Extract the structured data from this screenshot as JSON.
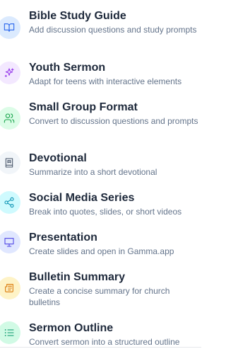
{
  "items": [
    {
      "title": "Bible Study Guide",
      "description": "Add discussion questions and study prompts",
      "icon": "book-open-icon",
      "color": "#2563eb",
      "bg": "#dbeafe"
    },
    {
      "title": "Youth Sermon",
      "description": "Adapt for teens with interactive elements",
      "icon": "sparkles-icon",
      "color": "#9333ea",
      "bg": "#f3e8ff"
    },
    {
      "title": "Small Group Format",
      "description": "Convert to discussion questions and prompts",
      "icon": "users-icon",
      "color": "#16a34a",
      "bg": "#dcfce7"
    },
    {
      "title": "Devotional",
      "description": "Summarize into a short devotional",
      "icon": "bookmark-book-icon",
      "color": "#475569",
      "bg": "#f1f5f9"
    },
    {
      "title": "Social Media Series",
      "description": "Break into quotes, slides, or short videos",
      "icon": "share-icon",
      "color": "#0891b2",
      "bg": "#cffafe"
    },
    {
      "title": "Presentation",
      "description": "Create slides and open in Gamma.app",
      "icon": "presentation-icon",
      "color": "#4f46e5",
      "bg": "#e0e7ff"
    },
    {
      "title": "Bulletin Summary",
      "description": "Create a concise summary for church bulletins",
      "icon": "newspaper-icon",
      "color": "#d97706",
      "bg": "#fef3c7"
    },
    {
      "title": "Sermon Outline",
      "description": "Convert sermon into a structured outline",
      "icon": "list-icon",
      "color": "#059669",
      "bg": "#d1fae5"
    }
  ]
}
